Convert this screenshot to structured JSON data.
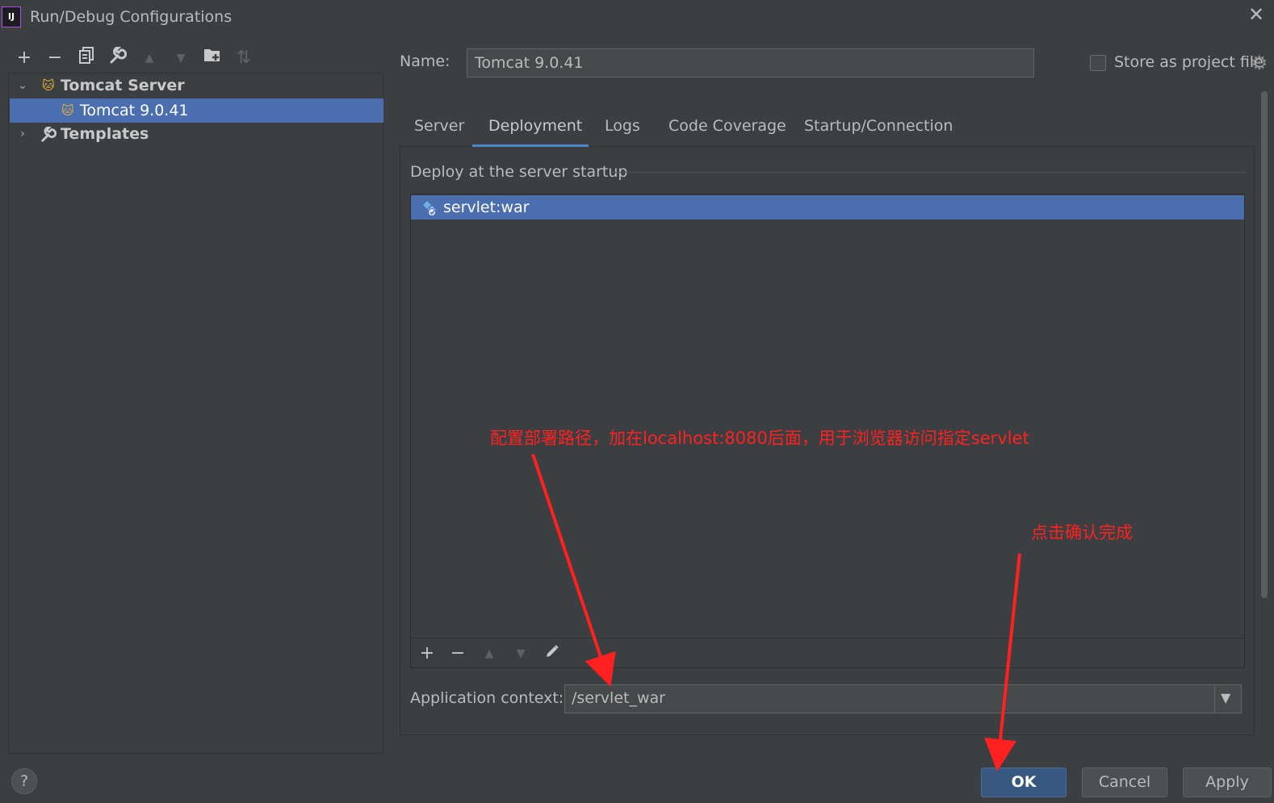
{
  "window": {
    "title": "Run/Debug Configurations",
    "app_icon_text": "IJ",
    "close_icon": "close-icon"
  },
  "left_toolbar": {
    "add": "+",
    "remove": "−",
    "copy": "⧉",
    "edit_defaults": "🔧",
    "move_up": "▲",
    "move_down": "▼",
    "new_folder": "📁",
    "sort": "⇅"
  },
  "tree": {
    "items": [
      {
        "label": "Tomcat Server",
        "expanded": true,
        "icon": "tomcat-icon"
      },
      {
        "label": "Tomcat 9.0.41",
        "selected": true,
        "icon": "tomcat-icon"
      },
      {
        "label": "Templates",
        "expanded": false,
        "icon": "wrench-icon"
      }
    ]
  },
  "header": {
    "name_label": "Name:",
    "name_value": "Tomcat 9.0.41",
    "store_label": "Store as project file",
    "store_checked": false
  },
  "tabs": [
    {
      "label": "Server"
    },
    {
      "label": "Deployment",
      "active": true
    },
    {
      "label": "Logs"
    },
    {
      "label": "Code Coverage"
    },
    {
      "label": "Startup/Connection"
    }
  ],
  "deployment": {
    "section_title": "Deploy at the server startup",
    "artifacts": [
      {
        "label": "servlet:war"
      }
    ],
    "toolbar": {
      "add": "+",
      "remove": "−",
      "up": "▲",
      "down": "▼",
      "edit": "✎"
    },
    "context_label": "Application context:",
    "context_value": "/servlet_war"
  },
  "buttons": {
    "help": "?",
    "ok": "OK",
    "cancel": "Cancel",
    "apply": "Apply"
  },
  "annotations": {
    "context_note": "配置部署路径，加在localhost:8080后面，用于浏览器访问指定servlet",
    "ok_note": "点击确认完成"
  },
  "colors": {
    "background": "#3c3f41",
    "selection": "#4b6eaf",
    "accent": "#4a88c7",
    "annotation": "#ff2020",
    "ok_button": "#365880"
  }
}
